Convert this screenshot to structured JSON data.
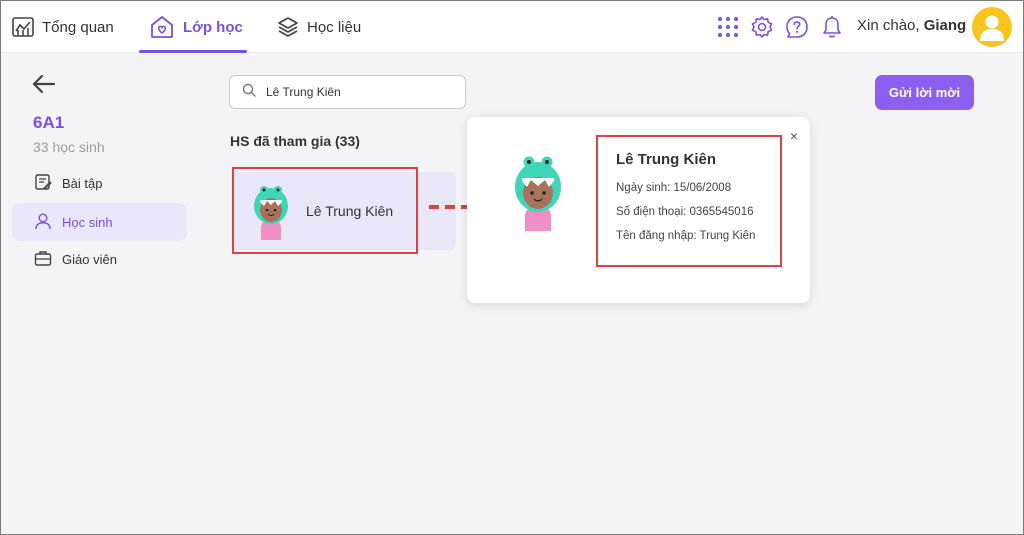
{
  "nav": {
    "overview": "Tổng quan",
    "classes": "Lớp học",
    "materials": "Học liệu"
  },
  "header": {
    "greeting_prefix": "Xin chào,",
    "user_name": "Giang"
  },
  "sidebar": {
    "class_name": "6A1",
    "student_count": "33 học sinh",
    "items": [
      {
        "label": "Bài tập"
      },
      {
        "label": "Học sinh"
      },
      {
        "label": "Giáo viên"
      }
    ]
  },
  "search": {
    "value": "Lê Trung Kiên"
  },
  "invite_button": "Gửi lời mời",
  "section_title": "HS đã tham gia (33)",
  "student": {
    "name": "Lê Trung Kiên"
  },
  "popup": {
    "name": "Lê Trung Kiên",
    "birthday": "Ngày sinh: 15/06/2008",
    "phone": "Số điện thoại: 0365545016",
    "username": "Tên đăng nhập: Trung Kiên",
    "close": "×"
  },
  "colors": {
    "accent": "#7b4fe0",
    "button": "#8b5ff0",
    "highlight": "#e04040"
  }
}
